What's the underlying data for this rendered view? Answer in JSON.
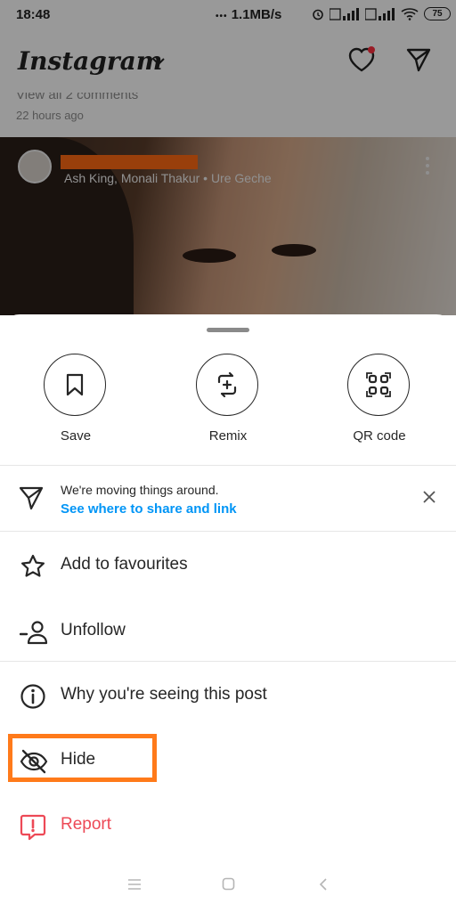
{
  "status_bar": {
    "time": "18:48",
    "net_speed": "1.1MB/s",
    "battery": "75"
  },
  "header": {
    "logo": "Instagram"
  },
  "feed": {
    "comments_text": "View all 2 comments",
    "time_ago": "22 hours ago",
    "music": "Ash King, Monali Thakur • Ure Geche"
  },
  "sheet": {
    "actions": [
      {
        "label": "Save",
        "icon": "bookmark-icon"
      },
      {
        "label": "Remix",
        "icon": "remix-icon"
      },
      {
        "label": "QR code",
        "icon": "qr-code-icon"
      }
    ],
    "banner": {
      "title": "We're moving things around.",
      "link": "See where to share and link"
    },
    "menu": [
      {
        "label": "Add to favourites",
        "icon": "star-icon"
      },
      {
        "label": "Unfollow",
        "icon": "unfollow-icon"
      },
      {
        "label": "Why you're seeing this post",
        "icon": "info-icon"
      },
      {
        "label": "Hide",
        "icon": "eye-off-icon"
      },
      {
        "label": "Report",
        "icon": "report-icon"
      }
    ]
  },
  "colors": {
    "accent_link": "#0095f6",
    "report_red": "#ed4956",
    "highlight": "#ff7a1a",
    "redaction": "#ff6a13"
  }
}
